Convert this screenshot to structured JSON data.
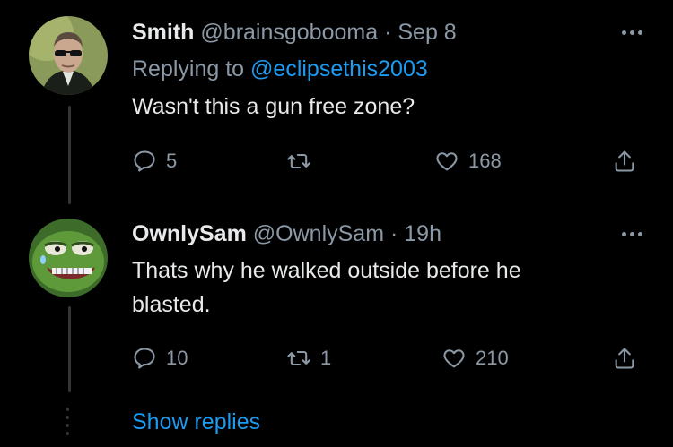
{
  "tweets": [
    {
      "name": "Smith",
      "handle": "@brainsgobooma",
      "separator": "·",
      "time": "Sep 8",
      "replying_prefix": "Replying to",
      "replying_to": "@eclipsethis2003",
      "text": "Wasn't this a gun free zone?",
      "replies": "5",
      "retweets": "",
      "likes": "168",
      "avatar_icon": "agent-smith-avatar"
    },
    {
      "name": "OwnlySam",
      "handle": "@OwnlySam",
      "separator": "·",
      "time": "19h",
      "text": "Thats why he walked outside before he blasted.",
      "replies": "10",
      "retweets": "1",
      "likes": "210",
      "avatar_icon": "pepe-frog-avatar"
    }
  ],
  "show_replies": "Show replies",
  "colors": {
    "background": "#000000",
    "text": "#e7e9ea",
    "muted": "#8b98a5",
    "link": "#1d9bf0",
    "thread_line": "#333639"
  }
}
